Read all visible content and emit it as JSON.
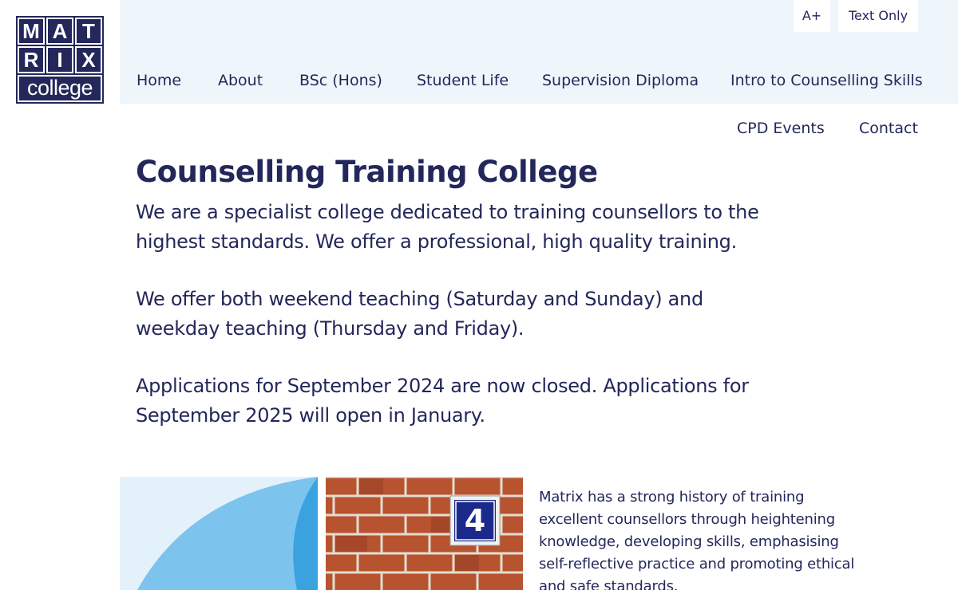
{
  "logo": {
    "letters": [
      "M",
      "A",
      "T",
      "R",
      "I",
      "X"
    ],
    "word": "college"
  },
  "utility": {
    "text_size_label": "A+",
    "text_only_label": "Text Only"
  },
  "nav": {
    "items": [
      "Home",
      "About",
      "BSc (Hons)",
      "Student Life",
      "Supervision Diploma",
      "Intro to Counselling Skills",
      "CPD Events",
      "Contact"
    ]
  },
  "main": {
    "title": "Counselling Training College",
    "paragraphs": [
      "We are a specialist college dedicated to training counsellors to the highest standards. We offer a professional, high quality training.",
      "We offer both weekend teaching (Saturday and Sunday) and weekday teaching (Thursday and Friday).",
      "Applications for September 2024 are now closed. Applications for September 2025 will open in January."
    ]
  },
  "feature": {
    "sign_number": "4",
    "text": "Matrix has a strong history of training excellent counsellors through heightening knowledge, developing skills, emphasising self-reflective practice and promoting ethical and safe standards."
  },
  "colors": {
    "navy": "#23275a",
    "band": "#eef6fb",
    "leaf_light": "#7cc3ee",
    "leaf_dark": "#3aa3df",
    "brick": "#b14e32"
  }
}
